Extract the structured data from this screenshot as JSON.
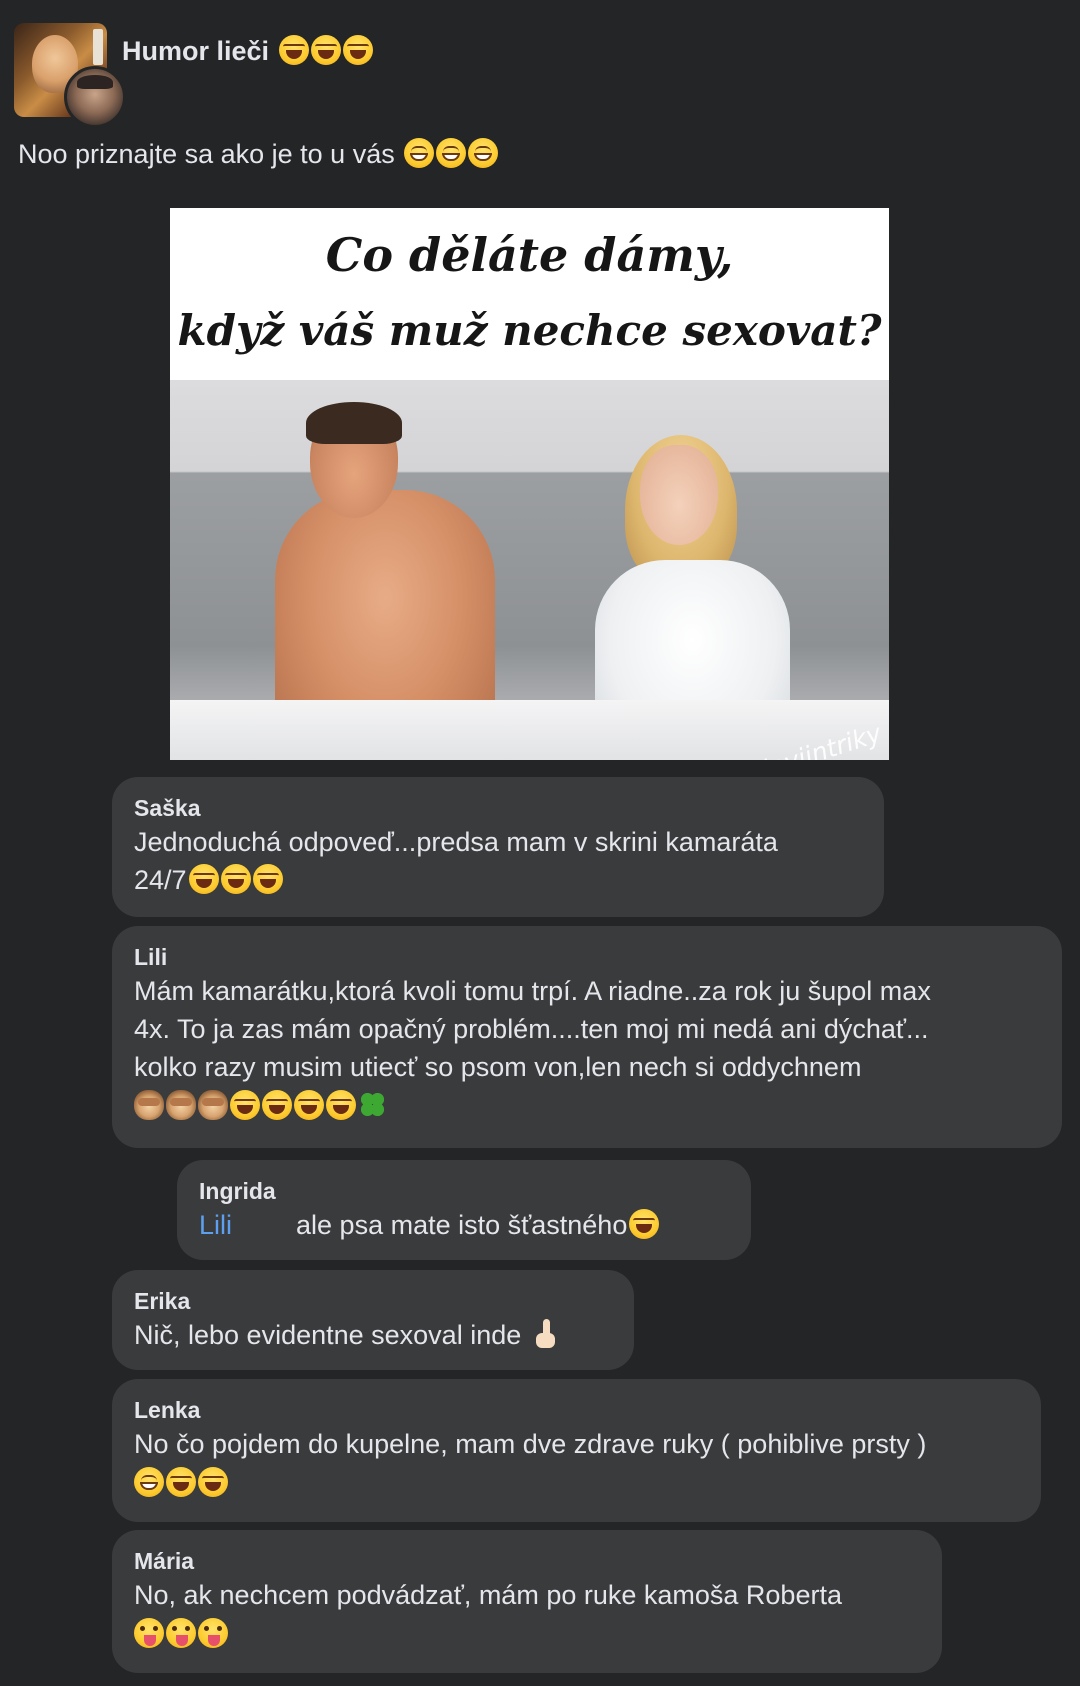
{
  "post": {
    "group_name": "Humor lieči",
    "group_name_emojis": [
      "rofl-emoji",
      "rofl-emoji",
      "rofl-emoji"
    ],
    "text": "Noo priznajte sa ako je to u vás",
    "text_emojis": [
      "grin-emoji",
      "grin-emoji",
      "grin-emoji"
    ]
  },
  "meme": {
    "caption_line1": "Co děláte dámy,",
    "caption_line2": "když váš muž nechce sexovat?",
    "watermark": "drtiloviintriky"
  },
  "comments": [
    {
      "author": "Saška",
      "line1": "Jednoduchá odpoveď...predsa mam v skrini kamaráta",
      "line2": "24/7"
    },
    {
      "author": "Lili",
      "line1": "Mám kamarátku,ktorá kvoli tomu trpí.  A riadne..za rok ju šupol max",
      "line2": "4x.  To ja zas mám opačný problém....ten moj mi nedá ani dýchať...",
      "line3": "kolko razy musim utiecť so psom von,len nech si oddychnem"
    },
    {
      "author": "Ingrida",
      "mention": "Lili",
      "line1": "ale psa mate isto šťastného"
    },
    {
      "author": "Erika",
      "line1": "Nič, lebo evidentne sexoval inde"
    },
    {
      "author": "Lenka",
      "line1": "No čo pojdem do kupelne, mam dve zdrave ruky ( pohiblive prsty )"
    },
    {
      "author": "Mária",
      "line1": "No, ak nechcem podvádzať, mám po ruke kamoša Roberta"
    }
  ],
  "colors": {
    "background": "#242526",
    "bubble": "#3a3b3c",
    "text": "#e4e6eb",
    "mention": "#5da0f0"
  }
}
